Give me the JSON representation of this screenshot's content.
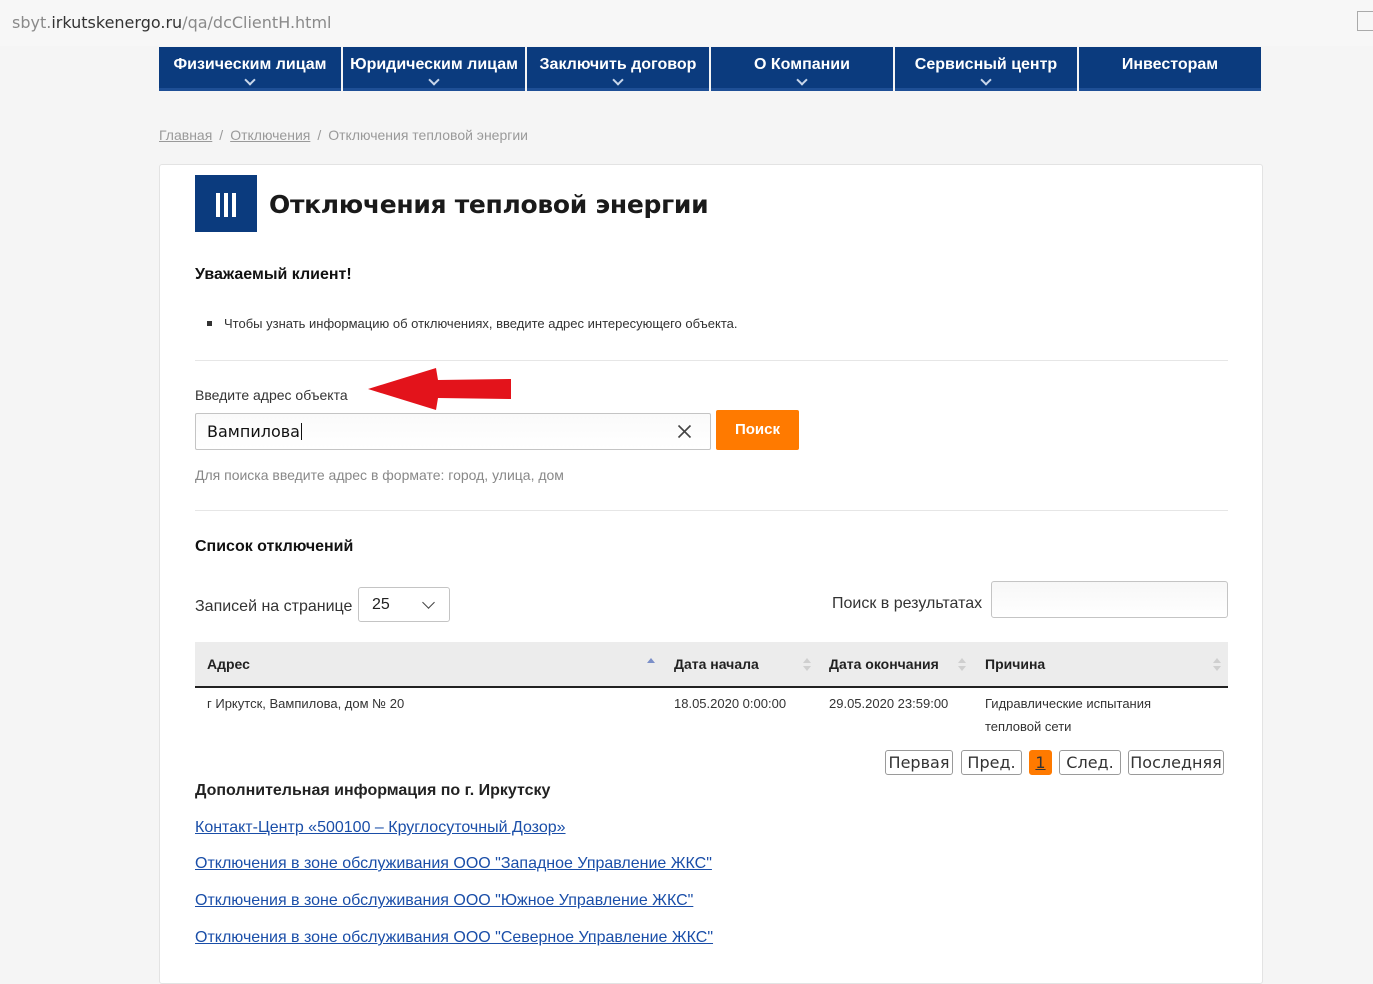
{
  "browser": {
    "url_prefix": "sbyt.",
    "url_host": "irkutskenergo.ru",
    "url_path": "/qa/dcClientH.html"
  },
  "nav": {
    "items": [
      {
        "label": "Физическим лицам",
        "has_dropdown": true
      },
      {
        "label": "Юридическим лицам",
        "has_dropdown": true
      },
      {
        "label": "Заключить договор",
        "has_dropdown": true
      },
      {
        "label": "О Компании",
        "has_dropdown": true
      },
      {
        "label": "Сервисный центр",
        "has_dropdown": true
      },
      {
        "label": "Инвесторам",
        "has_dropdown": false
      }
    ]
  },
  "breadcrumb": {
    "home": "Главная",
    "section": "Отключения",
    "current": "Отключения тепловой энергии",
    "separator": "/"
  },
  "page": {
    "title": "Отключения тепловой энергии",
    "greeting": "Уважаемый клиент!",
    "info": "Чтобы узнать информацию об отключениях, введите адрес интересующего объекта."
  },
  "search": {
    "label": "Введите адрес объекта",
    "value": "Вампилова",
    "button": "Поиск",
    "hint": "Для поиска введите адрес в формате: город, улица, дом"
  },
  "results": {
    "title": "Список отключений",
    "per_page_label": "Записей на странице",
    "per_page_value": "25",
    "filter_label": "Поиск в результатах",
    "columns": [
      "Адрес",
      "Дата начала",
      "Дата окончания",
      "Причина"
    ],
    "rows": [
      {
        "address": "г Иркутск, Вампилова, дом № 20",
        "start": "18.05.2020 0:00:00",
        "end": "29.05.2020 23:59:00",
        "reason_line1": "Гидравлические испытания",
        "reason_line2": "тепловой сети"
      }
    ]
  },
  "pagination": {
    "first": "Первая",
    "prev": "Пред.",
    "current": "1",
    "next": "След.",
    "last": "Последняя"
  },
  "extra": {
    "title": "Дополнительная информация по г. Иркутску",
    "links": [
      "Контакт-Центр «500100 – Круглосуточный Дозор»",
      "Отключения в зоне обслуживания ООО \"Западное Управление ЖКС\"",
      "Отключения в зоне обслуживания ООО \"Южное Управление ЖКС\"",
      "Отключения в зоне обслуживания ООО \"Северное Управление ЖКС\""
    ]
  },
  "colors": {
    "nav_bg": "#0b3b7e",
    "accent_orange": "#ff7a00",
    "link": "#1a4ea8",
    "annotation_arrow": "#e3131b"
  }
}
